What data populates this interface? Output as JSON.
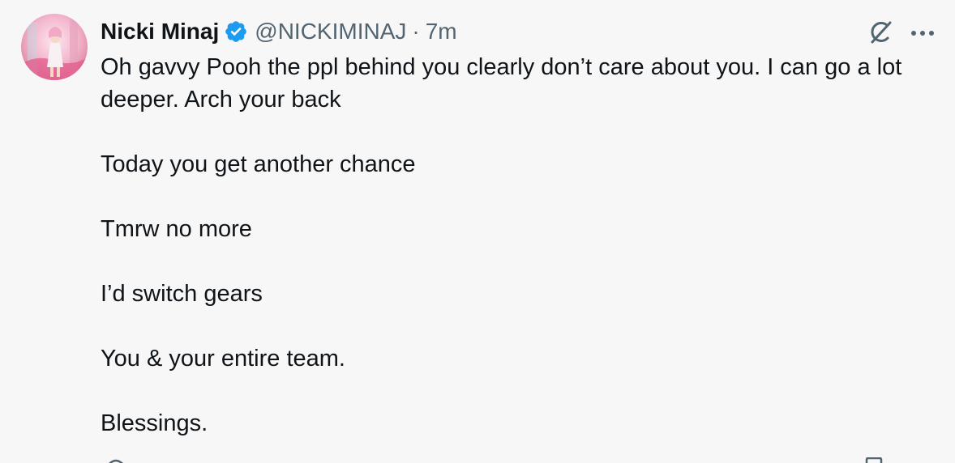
{
  "tweet": {
    "author": {
      "display_name": "Nicki Minaj",
      "handle": "@NICKIMINAJ",
      "verified": true
    },
    "separator": "·",
    "timestamp": "7m",
    "body_paragraphs": [
      "Oh gavvy Pooh the ppl behind you clearly don’t care about you. I can go a lot deeper. Arch your back",
      "Today you get another chance",
      "Tmrw no more",
      "I’d switch gears",
      "You & your entire team.",
      "Blessings."
    ],
    "icons": {
      "verified": "verified-badge-icon",
      "grok": "grok-icon",
      "more": "more-horizontal-icon",
      "reply": "reply-icon",
      "bookmark": "bookmark-icon"
    }
  },
  "colors": {
    "background": "#f7f7f7",
    "text_primary": "#0f1419",
    "text_secondary": "#536471",
    "verified_blue": "#1d9bf0"
  }
}
